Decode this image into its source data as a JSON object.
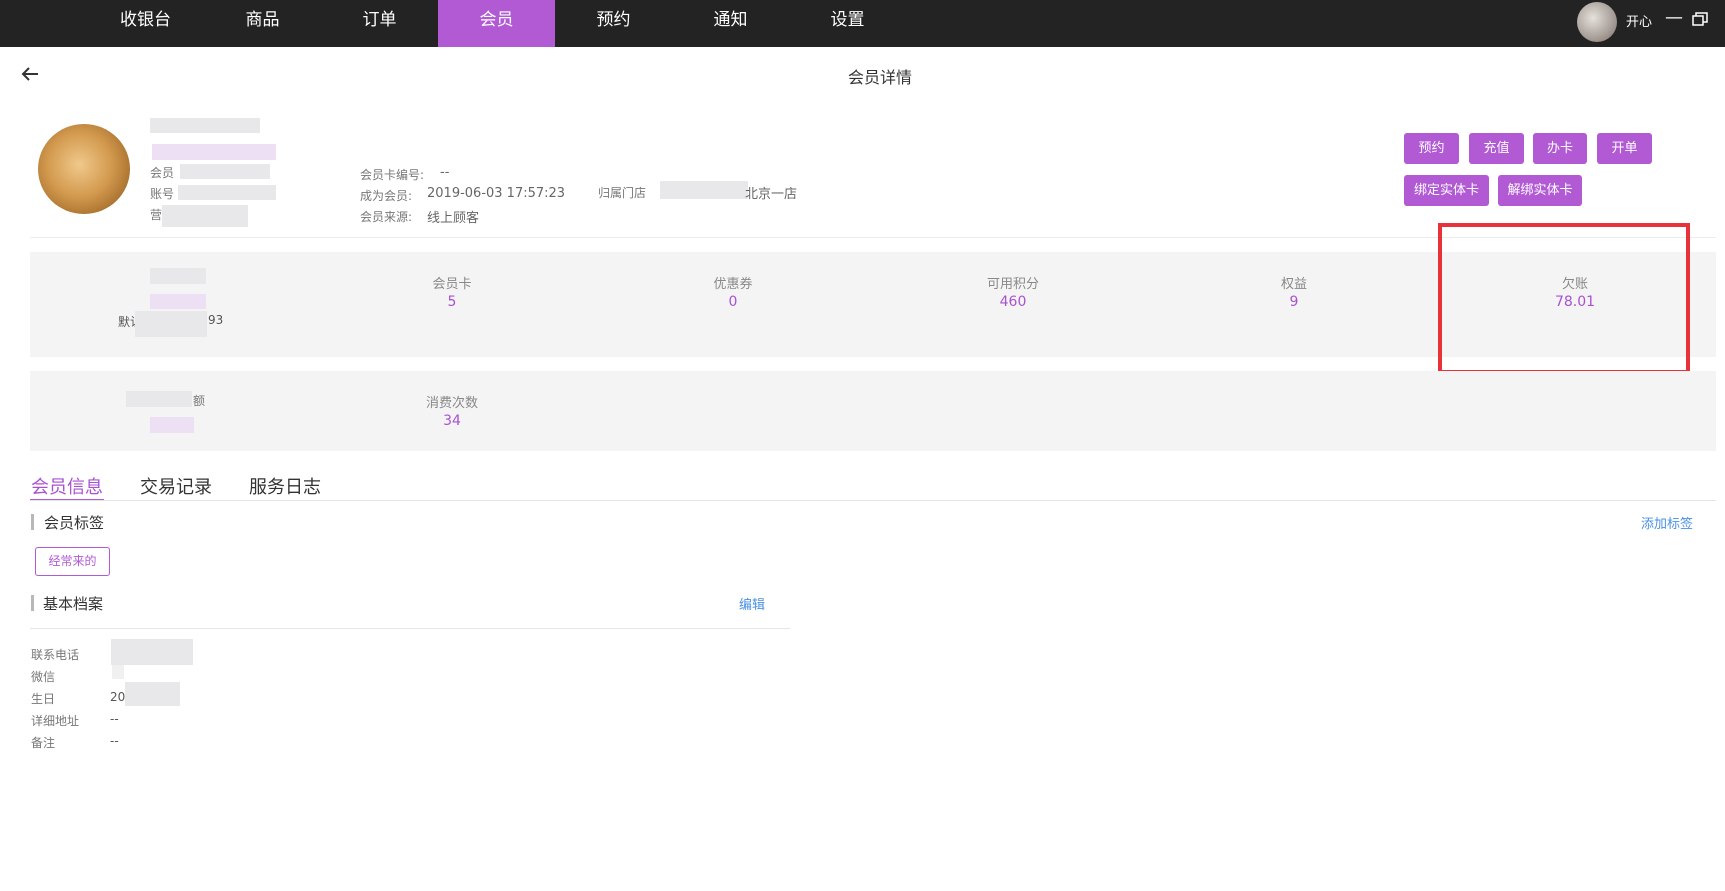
{
  "nav": {
    "items": [
      {
        "label": "收银台",
        "active": false
      },
      {
        "label": "商品",
        "active": false
      },
      {
        "label": "订单",
        "active": false
      },
      {
        "label": "会员",
        "active": true
      },
      {
        "label": "预约",
        "active": false
      },
      {
        "label": "通知",
        "active": false
      },
      {
        "label": "设置",
        "active": false
      }
    ],
    "user_name": "开心",
    "minimize_glyph": "—"
  },
  "page": {
    "title": "会员详情"
  },
  "profile": {
    "name_fragment": "",
    "field1_label": "会员",
    "field2_label": "账号",
    "field3_label": "营",
    "card_no_label": "会员卡编号:",
    "card_no_value": "--",
    "join_label": "成为会员:",
    "join_value": "2019-06-03 17:57:23",
    "source_label": "会员来源:",
    "source_value": "线上顾客",
    "store_label": "归属门店",
    "store_value": "北京一店"
  },
  "actions": {
    "appointment": "预约",
    "recharge": "充值",
    "card": "办卡",
    "open_order": "开单",
    "bind_card": "绑定实体卡",
    "unbind_card": "解绑实体卡"
  },
  "stats": {
    "default_label": "默认",
    "default_value_tail": "93",
    "member_card_label": "会员卡",
    "member_card_value": "5",
    "coupon_label": "优惠券",
    "coupon_value": "0",
    "points_label": "可用积分",
    "points_value": "460",
    "rights_label": "权益",
    "rights_value": "9",
    "debt_label": "欠账",
    "debt_value": "78.01",
    "amount_label_tail": "额",
    "consume_count_label": "消费次数",
    "consume_count_value": "34"
  },
  "tabs": [
    {
      "label": "会员信息",
      "active": true
    },
    {
      "label": "交易记录",
      "active": false
    },
    {
      "label": "服务日志",
      "active": false
    }
  ],
  "tags_section": {
    "title": "会员标签",
    "add_link": "添加标签",
    "tags": [
      "经常来的"
    ]
  },
  "basic_section": {
    "title": "基本档案",
    "edit_link": "编辑",
    "fields": [
      {
        "label": "联系电话",
        "value": ""
      },
      {
        "label": "微信",
        "value": ""
      },
      {
        "label": "生日",
        "value": "20"
      },
      {
        "label": "详细地址",
        "value": "--"
      },
      {
        "label": "备注",
        "value": "--"
      }
    ]
  },
  "colors": {
    "accent": "#b15ad4",
    "topbar": "#232323",
    "highlight": "#e8323a",
    "link": "#4a90e2"
  }
}
